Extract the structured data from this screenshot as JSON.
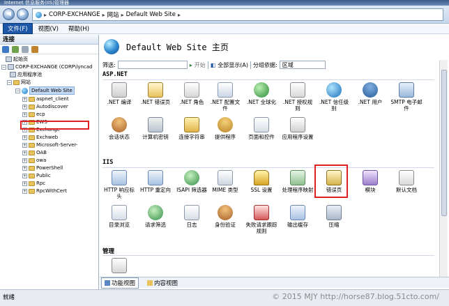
{
  "window": {
    "title": "Internet 信息服务(IIS)管理器"
  },
  "address": {
    "crumbs": [
      "CORP-EXCHANGE",
      "网站",
      "Default Web Site"
    ]
  },
  "menu": {
    "items": [
      "文件(F)",
      "视图(V)",
      "帮助(H)"
    ]
  },
  "connections": {
    "header": "连接",
    "tree": {
      "start": "起始页",
      "server": "CORP-EXCHANGE (CORP\\lyncad",
      "apppools": "应用程序池",
      "sites": "网站",
      "site": "Default Web Site",
      "children": [
        "aspnet_client",
        "Autodiscover",
        "ecp",
        "EWS",
        "Exchange",
        "Exchweb",
        "Microsoft-Server-",
        "OAB",
        "owa",
        "PowerShell",
        "Public",
        "Rpc",
        "RpcWithCert"
      ]
    }
  },
  "main": {
    "title": "Default Web Site 主页",
    "filter": {
      "label": "筛选:",
      "start": "开始",
      "showall": "全部显示(A)",
      "groupby": "分组依据:",
      "groupvalue": "区域"
    },
    "sections": {
      "aspnet": "ASP.NET",
      "iis": "IIS",
      "mgmt": "管理"
    },
    "aspnet_features": [
      ".NET 编译",
      ".NET 错误页",
      ".NET 角色",
      ".NET 配置文件",
      ".NET 全球化",
      ".NET 授权规则",
      ".NET 信任级别",
      ".NET 用户",
      "SMTP 电子邮件",
      "会话状态",
      "计算机密钥",
      "连接字符串",
      "提供程序",
      "页面和控件",
      "应用程序设置"
    ],
    "iis_features": [
      "HTTP 响应标头",
      "HTTP 重定向",
      "ISAPI 筛选器",
      "MIME 类型",
      "SSL 设置",
      "处理程序映射",
      "错误页",
      "模块",
      "默认文档",
      "目录浏览",
      "请求筛选",
      "日志",
      "身份验证",
      "失败请求跟踪规则",
      "输出缓存",
      "压缩"
    ]
  },
  "views": {
    "features": "功能视图",
    "content": "内容视图"
  },
  "status": {
    "text": "就绪"
  },
  "watermark": "© 2015 MJY http://horse87.blog.51cto.com/",
  "colors": {
    "accent": "#1c56a6",
    "highlight": "#e02020"
  }
}
